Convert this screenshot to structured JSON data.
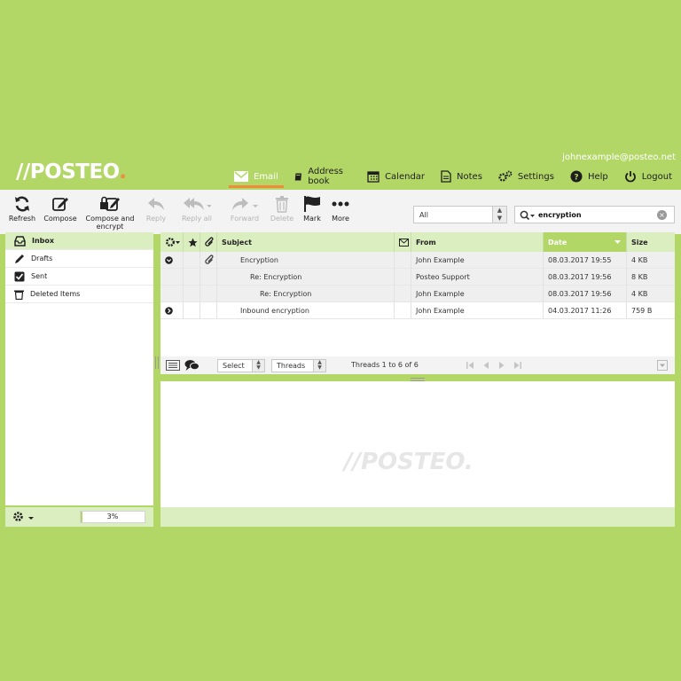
{
  "header": {
    "user_email": "johnexample@posteo.net",
    "logo": "//POSTEO",
    "logo_dot": ".",
    "nav": [
      {
        "label": "Email",
        "icon": "envelope-icon"
      },
      {
        "label": "Address book",
        "icon": "address-book-icon"
      },
      {
        "label": "Calendar",
        "icon": "calendar-icon"
      },
      {
        "label": "Notes",
        "icon": "notes-icon"
      },
      {
        "label": "Settings",
        "icon": "gears-icon"
      },
      {
        "label": "Help",
        "icon": "help-icon"
      },
      {
        "label": "Logout",
        "icon": "power-icon"
      }
    ]
  },
  "toolbar": {
    "refresh": "Refresh",
    "compose": "Compose",
    "compose_encrypt_1": "Compose and",
    "compose_encrypt_2": "encrypt",
    "reply": "Reply",
    "reply_all": "Reply all",
    "forward": "Forward",
    "delete": "Delete",
    "mark": "Mark",
    "more": "More",
    "filter_value": "All",
    "search_value": "encryption"
  },
  "folders": [
    {
      "label": "Inbox",
      "icon": "inbox-icon",
      "selected": true
    },
    {
      "label": "Drafts",
      "icon": "pencil-icon",
      "selected": false
    },
    {
      "label": "Sent",
      "icon": "checkbox-icon",
      "selected": false
    },
    {
      "label": "Deleted Items",
      "icon": "trash-icon",
      "selected": false
    }
  ],
  "quota": {
    "label": "3%",
    "fraction": 0.03
  },
  "list": {
    "headers": {
      "subject": "Subject",
      "from": "From",
      "date": "Date",
      "size": "Size"
    },
    "rows": [
      {
        "subject": "Encryption",
        "from": "John Example",
        "date": "08.03.2017 19:55",
        "size": "4 KB"
      },
      {
        "subject": "Re: Encryption",
        "from": "Posteo Support",
        "date": "08.03.2017 19:56",
        "size": "8 KB"
      },
      {
        "subject": "Re: Encryption",
        "from": "John Example",
        "date": "08.03.2017 19:56",
        "size": "4 KB"
      },
      {
        "subject": "Inbound encryption",
        "from": "John Example",
        "date": "04.03.2017 11:26",
        "size": "759 B"
      }
    ]
  },
  "list_footer": {
    "select": "Select",
    "threads": "Threads",
    "count": "Threads 1 to 6 of 6"
  },
  "preview": {
    "watermark": "//POSTEO."
  },
  "colors": {
    "brand_green": "#b3d767",
    "light_green": "#dbeec0",
    "accent_orange": "#f08a3c"
  }
}
